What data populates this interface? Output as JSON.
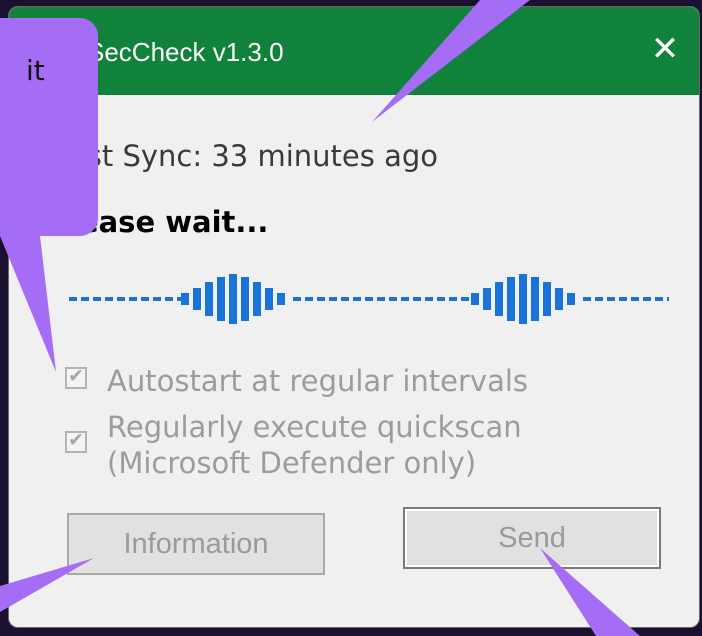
{
  "window": {
    "title": "SecCheck v1.3.0",
    "close_glyph": "✕"
  },
  "status": {
    "last_sync": "ast Sync: 33 minutes ago",
    "waiting": "lease wait..."
  },
  "options": [
    {
      "label": "Autostart at regular intervals",
      "checked": true,
      "enabled": false
    },
    {
      "label": "Regularly execute quickscan (Microsoft Defender only)",
      "line1": "Regularly execute quickscan",
      "line2": "(Microsoft Defender only)",
      "checked": true,
      "enabled": false
    }
  ],
  "buttons": {
    "information": "Information",
    "send": "Send"
  },
  "callout": {
    "text": "it",
    "color": "#a56cf5"
  },
  "colors": {
    "titlebar": "#11823b",
    "wave": "#1a74d8",
    "callout": "#a56cf5"
  },
  "progress": {
    "type": "indeterminate-wave"
  }
}
